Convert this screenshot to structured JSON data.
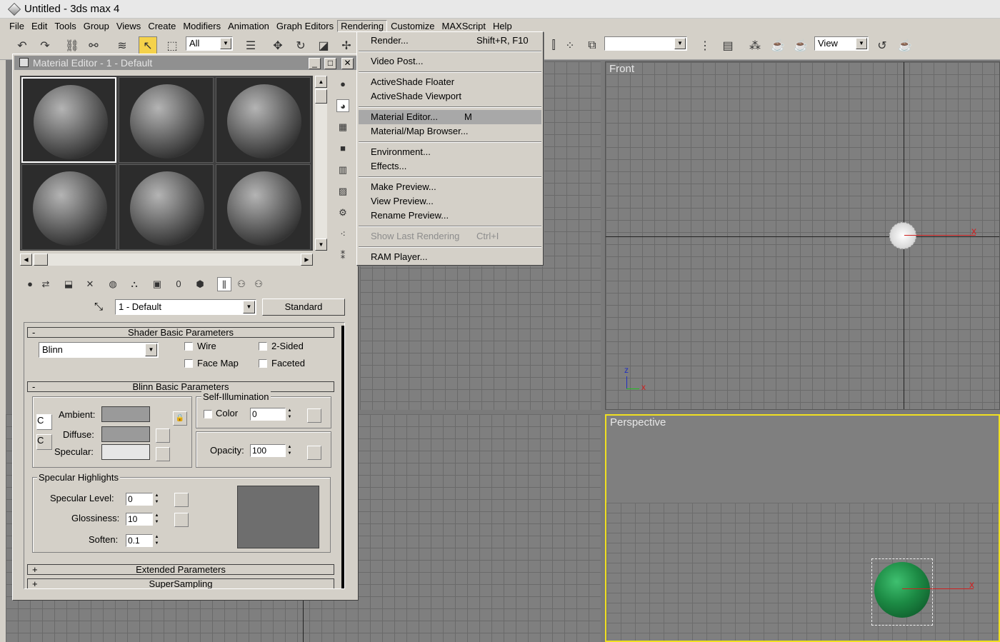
{
  "window": {
    "title": "Untitled - 3ds max 4"
  },
  "menubar": [
    "File",
    "Edit",
    "Tools",
    "Group",
    "Views",
    "Create",
    "Modifiers",
    "Animation",
    "Graph Editors",
    "Rendering",
    "Customize",
    "MAXScript",
    "Help"
  ],
  "toolbar": {
    "selection_filter": "All",
    "view_combo": "View"
  },
  "rendering_menu": {
    "items": [
      {
        "label": "Render...",
        "shortcut": "Shift+R, F10"
      },
      {
        "label": "Video Post..."
      },
      {
        "label": "ActiveShade Floater"
      },
      {
        "label": "ActiveShade Viewport"
      },
      {
        "label": "Material Editor...",
        "shortcut": "M"
      },
      {
        "label": "Material/Map Browser..."
      },
      {
        "label": "Environment..."
      },
      {
        "label": "Effects..."
      },
      {
        "label": "Make Preview..."
      },
      {
        "label": "View Preview..."
      },
      {
        "label": "Rename Preview..."
      },
      {
        "label": "Show Last Rendering",
        "shortcut": "Ctrl+I"
      },
      {
        "label": "RAM Player..."
      }
    ]
  },
  "viewports": {
    "front_label": "Front",
    "perspective_label": "Perspective",
    "axis_z": "z",
    "axis_x": "x"
  },
  "material_editor": {
    "title": "Material Editor - 1 - Default",
    "material_name": "1 - Default",
    "material_type": "Standard",
    "shader_rollout": {
      "title": "Shader Basic Parameters",
      "collapse": "-",
      "shader": "Blinn",
      "wire": "Wire",
      "two_sided": "2-Sided",
      "face_map": "Face Map",
      "faceted": "Faceted"
    },
    "blinn_rollout": {
      "title": "Blinn Basic Parameters",
      "collapse": "-",
      "self_illum_title": "Self-Illumination",
      "color_label": "Color",
      "color_value": "0",
      "ambient": "Ambient:",
      "diffuse": "Diffuse:",
      "specular": "Specular:",
      "opacity_label": "Opacity:",
      "opacity_value": "100",
      "ambient_color": "#9a9a9a",
      "diffuse_color": "#9a9a9a",
      "specular_color": "#e6e6e6"
    },
    "specular_highlights": {
      "title": "Specular Highlights",
      "level_label": "Specular Level:",
      "level_value": "0",
      "gloss_label": "Glossiness:",
      "gloss_value": "10",
      "soften_label": "Soften:",
      "soften_value": "0.1"
    },
    "extended_rollout": {
      "title": "Extended Parameters",
      "expand": "+"
    },
    "supersampling_rollout": {
      "title": "SuperSampling",
      "expand": "+"
    }
  }
}
